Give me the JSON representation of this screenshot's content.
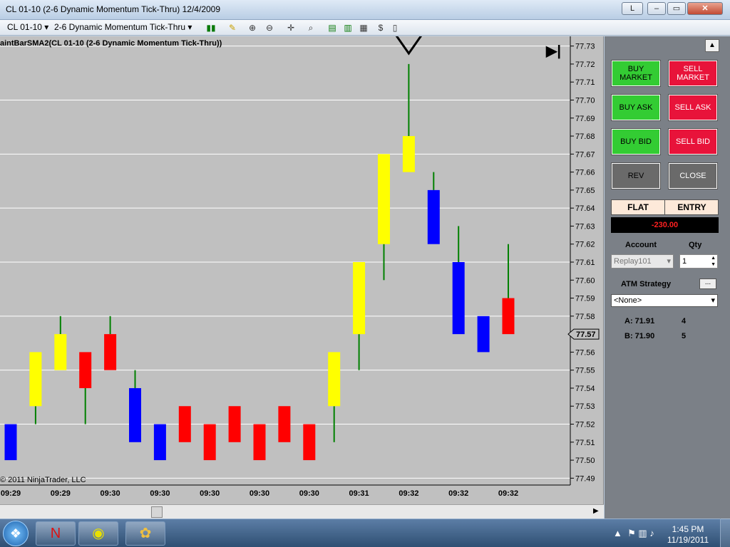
{
  "window": {
    "title": "CL 01-10 (2-6 Dynamic Momentum Tick-Thru)  12/4/2009",
    "link_btn": "L",
    "min_icon": "minimize-icon",
    "max_icon": "maximize-icon",
    "close_icon": "close-icon"
  },
  "toolbar": {
    "instrument": "CL 01-10",
    "period": "2-6 Dynamic Momentum Tick-Thru",
    "icons": [
      "bar-type-icon",
      "pencil-icon",
      "zoom-in-icon",
      "zoom-out-icon",
      "crosshair-icon",
      "magnify-icon",
      "panel-icon",
      "data-box-icon",
      "chart-properties-icon",
      "strategy-icon",
      "lock-icon"
    ]
  },
  "chart": {
    "label": "aintBarSMA2(CL 01-10 (2-6 Dynamic Momentum Tick-Thru))",
    "copyright": "© 2011 NinjaTrader, LLC",
    "current_price_label": "77.57",
    "end_icon": "jump-to-end-icon",
    "colors": {
      "up": "#ffff00",
      "down": "#ff0000",
      "strong_down": "#0000ff",
      "wick": "#008000",
      "grid": "#ffffff",
      "background": "#c0c0c0"
    }
  },
  "chart_data": {
    "type": "candlestick",
    "ylim": [
      77.485,
      77.735
    ],
    "y_ticks": [
      "77.49",
      "77.50",
      "77.51",
      "77.52",
      "77.53",
      "77.54",
      "77.55",
      "77.56",
      "77.57",
      "77.58",
      "77.59",
      "77.60",
      "77.61",
      "77.62",
      "77.63",
      "77.64",
      "77.65",
      "77.66",
      "77.67",
      "77.68",
      "77.69",
      "77.70",
      "77.71",
      "77.72",
      "77.73"
    ],
    "x_labels": [
      "09:29",
      "09:29",
      "09:30",
      "09:30",
      "09:30",
      "09:30",
      "09:30",
      "09:31",
      "09:32",
      "09:32",
      "09:32"
    ],
    "candles": [
      {
        "open": 77.52,
        "close": 77.5,
        "high": 77.52,
        "low": 77.5,
        "color": "blue"
      },
      {
        "open": 77.53,
        "close": 77.56,
        "high": 77.56,
        "low": 77.52,
        "color": "yellow"
      },
      {
        "open": 77.55,
        "close": 77.57,
        "high": 77.58,
        "low": 77.55,
        "color": "yellow"
      },
      {
        "open": 77.56,
        "close": 77.54,
        "high": 77.56,
        "low": 77.52,
        "color": "red"
      },
      {
        "open": 77.57,
        "close": 77.55,
        "high": 77.58,
        "low": 77.55,
        "color": "red"
      },
      {
        "open": 77.54,
        "close": 77.51,
        "high": 77.55,
        "low": 77.51,
        "color": "blue"
      },
      {
        "open": 77.52,
        "close": 77.5,
        "high": 77.52,
        "low": 77.5,
        "color": "blue"
      },
      {
        "open": 77.53,
        "close": 77.51,
        "high": 77.53,
        "low": 77.51,
        "color": "red"
      },
      {
        "open": 77.52,
        "close": 77.5,
        "high": 77.52,
        "low": 77.5,
        "color": "red"
      },
      {
        "open": 77.53,
        "close": 77.51,
        "high": 77.53,
        "low": 77.51,
        "color": "red"
      },
      {
        "open": 77.52,
        "close": 77.5,
        "high": 77.52,
        "low": 77.5,
        "color": "red"
      },
      {
        "open": 77.53,
        "close": 77.51,
        "high": 77.53,
        "low": 77.51,
        "color": "red"
      },
      {
        "open": 77.52,
        "close": 77.5,
        "high": 77.52,
        "low": 77.5,
        "color": "red"
      },
      {
        "open": 77.53,
        "close": 77.56,
        "high": 77.56,
        "low": 77.51,
        "color": "yellow"
      },
      {
        "open": 77.57,
        "close": 77.61,
        "high": 77.61,
        "low": 77.55,
        "color": "yellow"
      },
      {
        "open": 77.62,
        "close": 77.67,
        "high": 77.67,
        "low": 77.6,
        "color": "yellow"
      },
      {
        "open": 77.66,
        "close": 77.68,
        "high": 77.72,
        "low": 77.66,
        "color": "yellow"
      },
      {
        "open": 77.65,
        "close": 77.62,
        "high": 77.66,
        "low": 77.62,
        "color": "blue"
      },
      {
        "open": 77.61,
        "close": 77.57,
        "high": 77.63,
        "low": 77.57,
        "color": "blue"
      },
      {
        "open": 77.58,
        "close": 77.56,
        "high": 77.58,
        "low": 77.56,
        "color": "blue"
      },
      {
        "open": 77.59,
        "close": 77.57,
        "high": 77.62,
        "low": 77.57,
        "color": "red"
      }
    ],
    "marker": {
      "type": "arrow-down",
      "candle_index": 16
    }
  },
  "scroll": {
    "right_icon": "scroll-right-icon",
    "up_icon": "scroll-up-icon"
  },
  "panel": {
    "buy_market": "BUY MARKET",
    "sell_market": "SELL MARKET",
    "buy_ask": "BUY ASK",
    "sell_ask": "SELL ASK",
    "buy_bid": "BUY BID",
    "sell_bid": "SELL BID",
    "rev": "REV",
    "close": "CLOSE",
    "flat": "FLAT",
    "entry": "ENTRY",
    "pnl": "-230.00",
    "account_label": "Account",
    "qty_label": "Qty",
    "account_value": "Replay101",
    "qty_value": "1",
    "atm_label": "ATM Strategy",
    "atm_btn": "...",
    "atm_value": "<None>",
    "ask_label": "A: 71.91",
    "ask_size": "4",
    "bid_label": "B: 71.90",
    "bid_size": "5"
  },
  "taskbar": {
    "start_icon": "windows-start-icon",
    "apps": [
      "ninjatrader-icon",
      "chrome-icon",
      "paint-icon"
    ],
    "time": "1:45 PM",
    "date": "11/19/2011"
  }
}
